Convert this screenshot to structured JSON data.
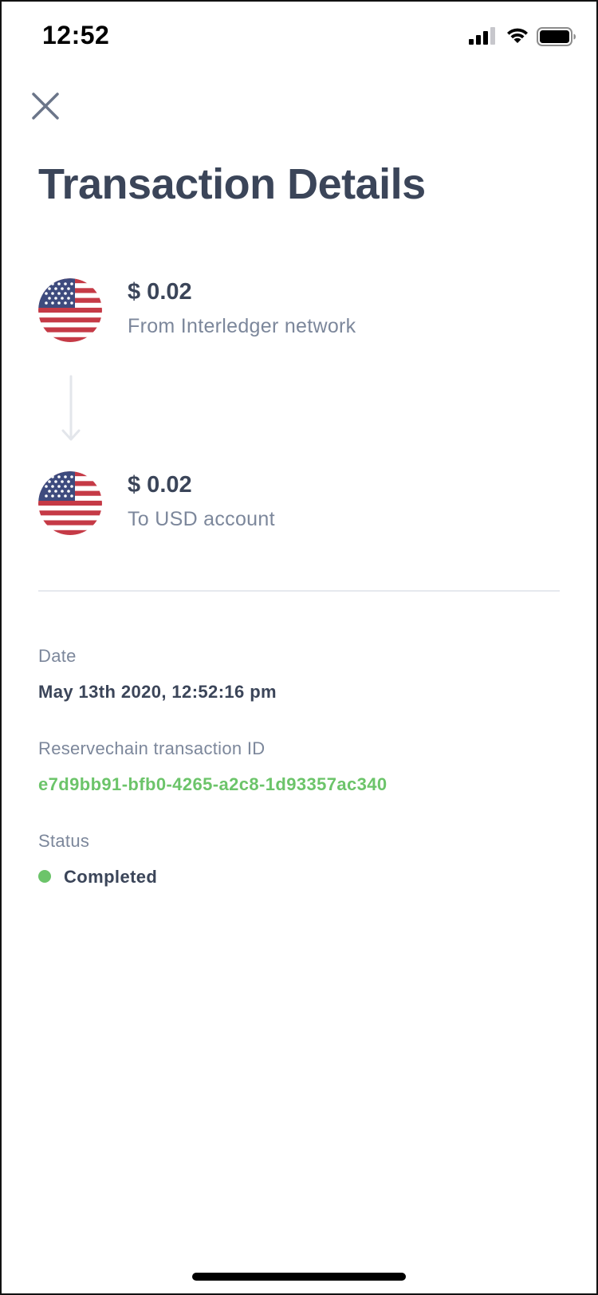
{
  "status_bar": {
    "time": "12:52",
    "icons": [
      "cellular-signal-icon",
      "wifi-icon",
      "battery-icon"
    ]
  },
  "header": {
    "close_icon": "close-icon",
    "title": "Transaction Details"
  },
  "transfer": {
    "from": {
      "flag": "us-flag-icon",
      "amount": "$ 0.02",
      "description": "From Interledger network"
    },
    "to": {
      "flag": "us-flag-icon",
      "amount": "$ 0.02",
      "description": "To USD account"
    },
    "arrow_icon": "arrow-down-icon"
  },
  "details": {
    "date_label": "Date",
    "date_value": "May 13th 2020, 12:52:16 pm",
    "txid_label": "Reservechain transaction ID",
    "txid_value": "e7d9bb91-bfb0-4265-a2c8-1d93357ac340",
    "status_label": "Status",
    "status_value": "Completed"
  },
  "colors": {
    "text_dark": "#3b4559",
    "text_muted": "#7c879b",
    "accent_green": "#6cc46a",
    "divider": "#e6e9ee"
  }
}
